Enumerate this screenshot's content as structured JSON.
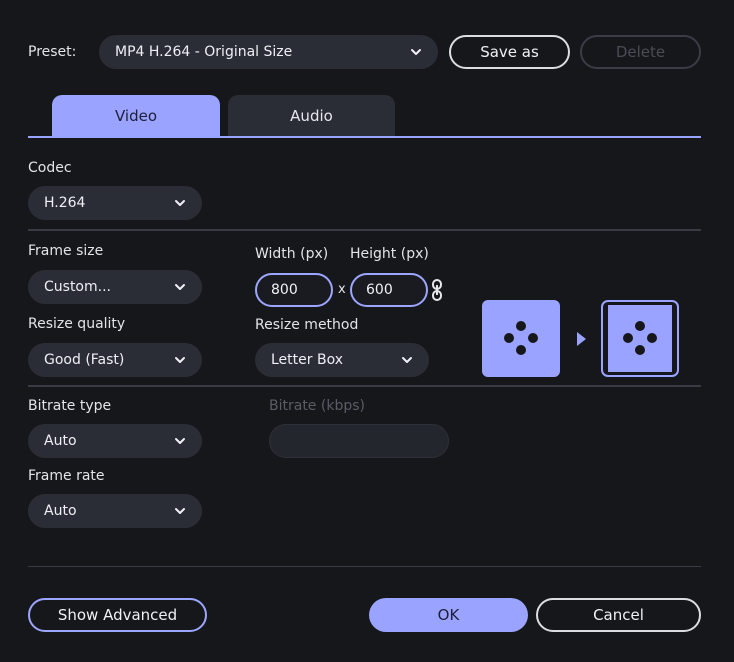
{
  "preset": {
    "label": "Preset:",
    "value": "MP4 H.264 - Original Size",
    "save_as": "Save as",
    "delete": "Delete"
  },
  "tabs": [
    {
      "label": "Video",
      "active": true
    },
    {
      "label": "Audio",
      "active": false
    }
  ],
  "codec": {
    "label": "Codec",
    "value": "H.264"
  },
  "frame_size": {
    "label": "Frame size",
    "value": "Custom..."
  },
  "dimensions": {
    "width_label": "Width (px)",
    "height_label": "Height (px)",
    "width": "800",
    "separator": "x",
    "height": "600"
  },
  "resize_quality": {
    "label": "Resize quality",
    "value": "Good (Fast)"
  },
  "resize_method": {
    "label": "Resize method",
    "value": "Letter Box"
  },
  "bitrate_type": {
    "label": "Bitrate type",
    "value": "Auto"
  },
  "bitrate": {
    "label": "Bitrate (kbps)",
    "value": ""
  },
  "frame_rate": {
    "label": "Frame rate",
    "value": "Auto"
  },
  "footer": {
    "show_advanced": "Show Advanced",
    "ok": "OK",
    "cancel": "Cancel"
  },
  "colors": {
    "accent": "#9aa3ff",
    "background": "#16171b",
    "control": "#2b2d36"
  }
}
